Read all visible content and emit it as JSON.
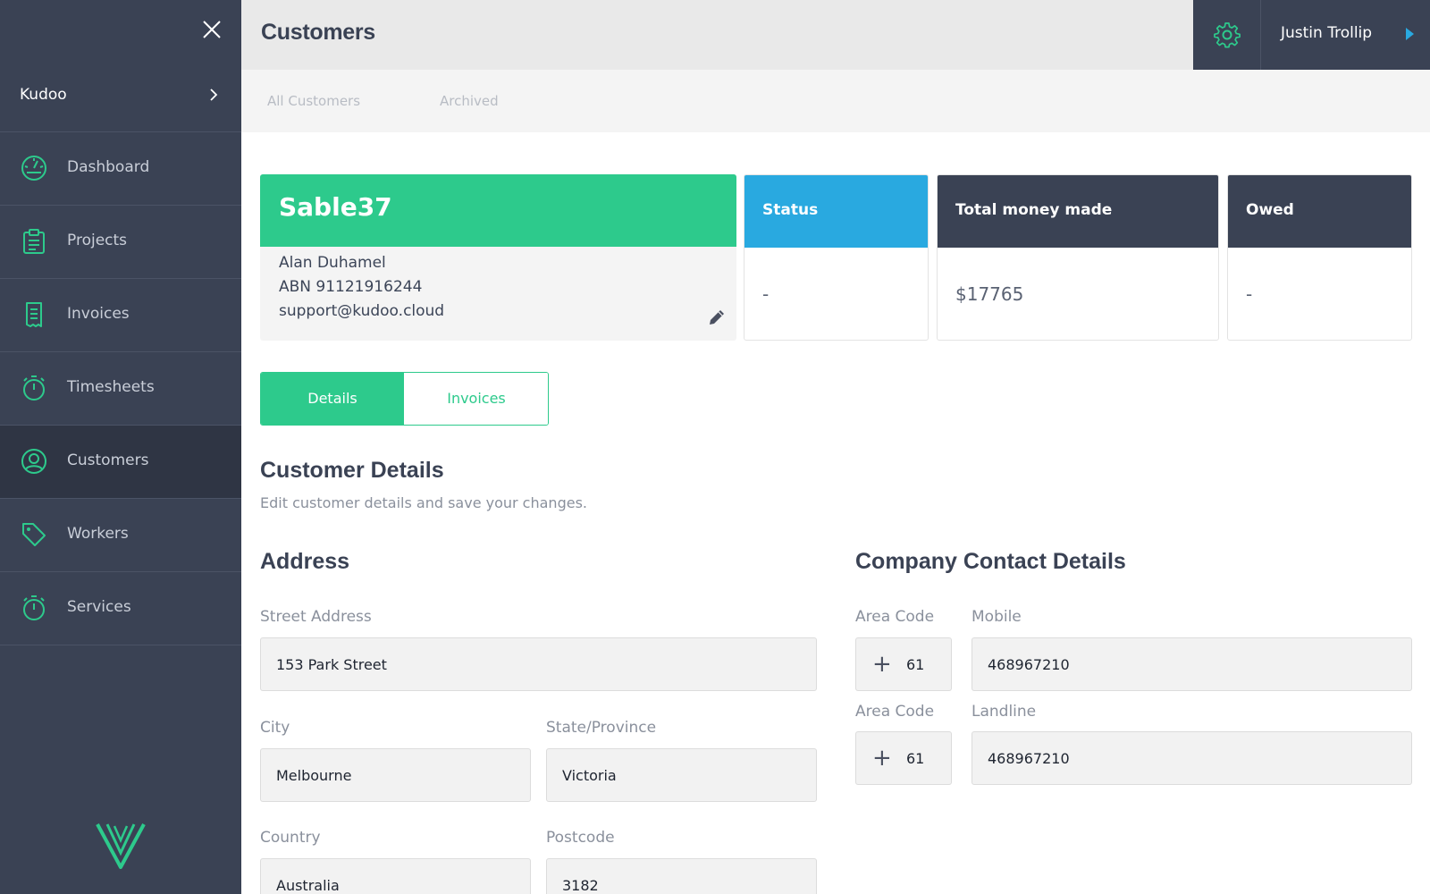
{
  "sidebar": {
    "org_name": "Kudoo",
    "items": [
      {
        "label": "Dashboard"
      },
      {
        "label": "Projects"
      },
      {
        "label": "Invoices"
      },
      {
        "label": "Timesheets"
      },
      {
        "label": "Customers"
      },
      {
        "label": "Workers"
      },
      {
        "label": "Services"
      }
    ],
    "active_item": "Customers"
  },
  "header": {
    "title": "Customers",
    "user_name": "Justin Trollip"
  },
  "subtabs": [
    "All Customers",
    "Archived"
  ],
  "customer": {
    "name": "Sable37",
    "contact": "Alan Duhamel",
    "abn": "ABN 91121916244",
    "email": "support@kudoo.cloud"
  },
  "cards": {
    "status": {
      "title": "Status",
      "value": "-"
    },
    "total": {
      "title": "Total money made",
      "value": "$17765"
    },
    "owed": {
      "title": "Owed",
      "value": "-"
    }
  },
  "detail_tabs": {
    "details": "Details",
    "invoices": "Invoices"
  },
  "section": {
    "title": "Customer Details",
    "subtitle": "Edit customer details and save your changes."
  },
  "address": {
    "title": "Address",
    "street_label": "Street Address",
    "street": "153 Park Street",
    "city_label": "City",
    "city": "Melbourne",
    "state_label": "State/Province",
    "state": "Victoria",
    "country_label": "Country",
    "country": "Australia",
    "postcode_label": "Postcode",
    "postcode": "3182"
  },
  "contact": {
    "title": "Company Contact Details",
    "area_code_label": "Area Code",
    "mobile_label": "Mobile",
    "mobile_area_code": "61",
    "mobile": "468967210",
    "landline_label": "Landline",
    "landline_area_code": "61",
    "landline": "468967210"
  },
  "colors": {
    "accent_green": "#2dca8c",
    "accent_blue": "#29a9e0",
    "sidebar": "#3a4254"
  }
}
